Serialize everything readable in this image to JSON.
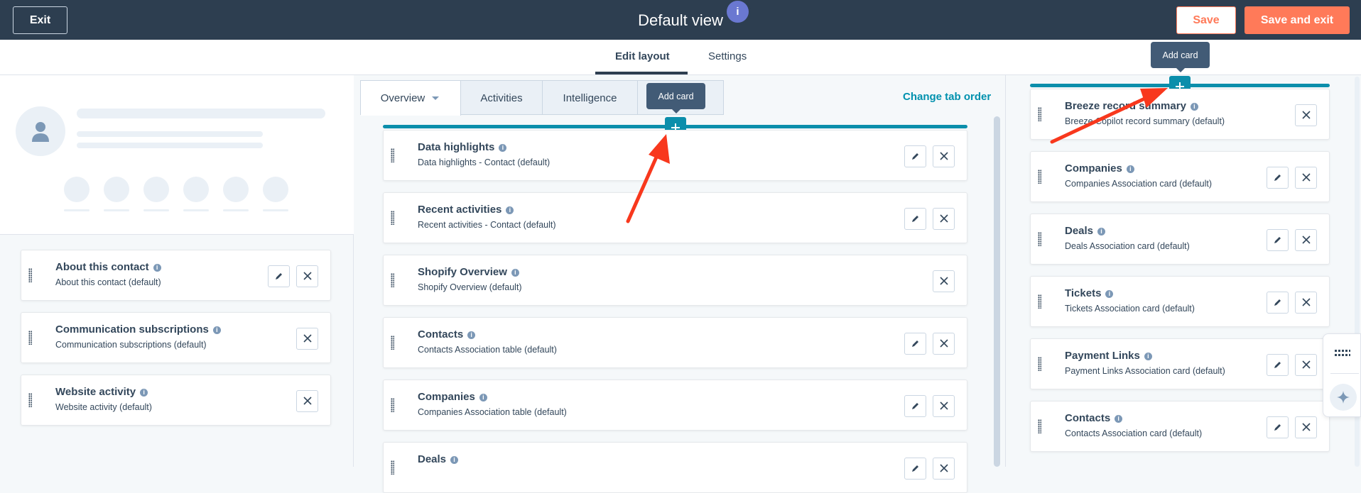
{
  "header": {
    "exit_label": "Exit",
    "title": "Default view",
    "info_badge": "i",
    "save_label": "Save",
    "save_exit_label": "Save and exit"
  },
  "subnav": {
    "tabs": [
      {
        "label": "Edit layout",
        "active": true
      },
      {
        "label": "Settings",
        "active": false
      }
    ]
  },
  "left_cards": [
    {
      "title": "About this contact",
      "subtitle": "About this contact (default)",
      "editable": true
    },
    {
      "title": "Communication subscriptions",
      "subtitle": "Communication subscriptions (default)",
      "editable": false
    },
    {
      "title": "Website activity",
      "subtitle": "Website activity (default)",
      "editable": false
    }
  ],
  "middle": {
    "tabs": [
      {
        "label": "Overview",
        "active": true
      },
      {
        "label": "Activities",
        "active": false
      },
      {
        "label": "Intelligence",
        "active": false
      }
    ],
    "change_tab_order": "Change tab order",
    "add_card_tooltip": "Add card",
    "cards": [
      {
        "title": "Data highlights",
        "subtitle": "Data highlights - Contact (default)",
        "editable": true
      },
      {
        "title": "Recent activities",
        "subtitle": "Recent activities - Contact (default)",
        "editable": true
      },
      {
        "title": "Shopify Overview",
        "subtitle": "Shopify Overview (default)",
        "editable": false
      },
      {
        "title": "Contacts",
        "subtitle": "Contacts Association table (default)",
        "editable": true
      },
      {
        "title": "Companies",
        "subtitle": "Companies Association table (default)",
        "editable": true
      },
      {
        "title": "Deals",
        "subtitle": "",
        "editable": true
      }
    ]
  },
  "right": {
    "add_card_tooltip": "Add card",
    "cards": [
      {
        "title": "Breeze record summary",
        "subtitle": "Breeze Copilot record summary (default)",
        "editable": false
      },
      {
        "title": "Companies",
        "subtitle": "Companies Association card (default)",
        "editable": true
      },
      {
        "title": "Deals",
        "subtitle": "Deals Association card (default)",
        "editable": true
      },
      {
        "title": "Tickets",
        "subtitle": "Tickets Association card (default)",
        "editable": true
      },
      {
        "title": "Payment Links",
        "subtitle": "Payment Links Association card (default)",
        "editable": true
      },
      {
        "title": "Contacts",
        "subtitle": "Contacts Association card (default)",
        "editable": true
      }
    ]
  },
  "colors": {
    "header_bg": "#2d3e50",
    "accent_orange": "#ff7a59",
    "accent_teal": "#0b8eab",
    "annotation_arrow": "#f8381d"
  }
}
